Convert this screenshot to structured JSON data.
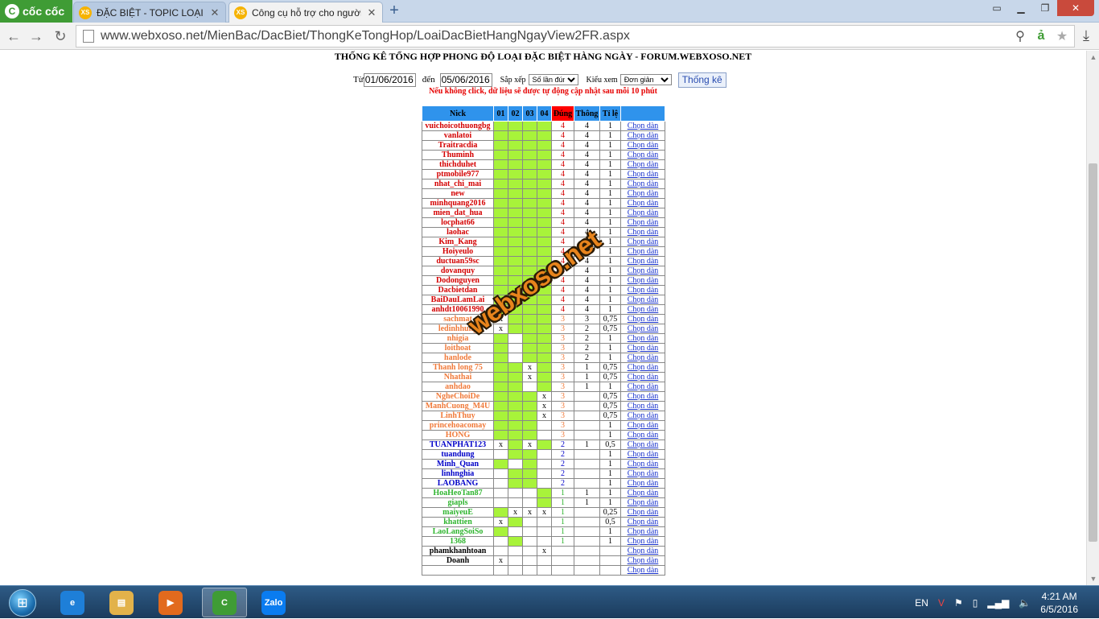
{
  "browser": {
    "logo": "cốc cốc",
    "tabs": [
      {
        "favicon": "XS",
        "title": "ĐẶC BIỆT - TOPIC LOẠI ĐẶ"
      },
      {
        "favicon": "XS",
        "title": "Công cụ hỗ trợ cho người"
      }
    ],
    "new_tab": "+",
    "url": "www.webxoso.net/MienBac/DacBiet/ThongKeTongHop/LoaiDacBietHangNgayView2FR.aspx"
  },
  "page": {
    "title": "THỐNG KÊ TỔNG HỢP PHONG ĐỘ LOẠI ĐẶC BIỆT HÀNG NGÀY - FORUM.WEBXOSO.NET",
    "from_label": "Từ",
    "from_value": "01/06/2016",
    "to_label": "đến",
    "to_value": "05/06/2016",
    "sort_label": "Sắp xếp",
    "sort_value": "Số lần đúng",
    "view_label": "Kiểu xem",
    "view_value": "Đơn giản",
    "submit_label": "Thống kê",
    "note": "Nếu không click, dữ liệu sẽ được tự động cập nhật sau mỗi 10 phút",
    "watermark": "webxoso.net"
  },
  "table": {
    "headers": [
      "Nick",
      "01",
      "02",
      "03",
      "04",
      "Đúng",
      "Thông",
      "Tỉ lệ",
      ""
    ],
    "link_label": "Chọn dàn",
    "colors": {
      "4": "#d40000",
      "3": "#f07a3a",
      "2": "#0000c8",
      "1": "#2fb52f",
      "0": "#000000"
    },
    "rows": [
      {
        "nick": "vuichoicothuongbg",
        "d": [
          "g",
          "g",
          "g",
          "g"
        ],
        "dung": "4",
        "thong": "4",
        "tile": "1"
      },
      {
        "nick": "vanlatoi",
        "d": [
          "g",
          "g",
          "g",
          "g"
        ],
        "dung": "4",
        "thong": "4",
        "tile": "1"
      },
      {
        "nick": "Traitracdia",
        "d": [
          "g",
          "g",
          "g",
          "g"
        ],
        "dung": "4",
        "thong": "4",
        "tile": "1"
      },
      {
        "nick": "Thuminh",
        "d": [
          "g",
          "g",
          "g",
          "g"
        ],
        "dung": "4",
        "thong": "4",
        "tile": "1"
      },
      {
        "nick": "thichduhet",
        "d": [
          "g",
          "g",
          "g",
          "g"
        ],
        "dung": "4",
        "thong": "4",
        "tile": "1"
      },
      {
        "nick": "ptmobile977",
        "d": [
          "g",
          "g",
          "g",
          "g"
        ],
        "dung": "4",
        "thong": "4",
        "tile": "1"
      },
      {
        "nick": "nhat_chi_mai",
        "d": [
          "g",
          "g",
          "g",
          "g"
        ],
        "dung": "4",
        "thong": "4",
        "tile": "1"
      },
      {
        "nick": "new",
        "d": [
          "g",
          "g",
          "g",
          "g"
        ],
        "dung": "4",
        "thong": "4",
        "tile": "1"
      },
      {
        "nick": "minhquang2016",
        "d": [
          "g",
          "g",
          "g",
          "g"
        ],
        "dung": "4",
        "thong": "4",
        "tile": "1"
      },
      {
        "nick": "mien_dat_hua",
        "d": [
          "g",
          "g",
          "g",
          "g"
        ],
        "dung": "4",
        "thong": "4",
        "tile": "1"
      },
      {
        "nick": "locphat66",
        "d": [
          "g",
          "g",
          "g",
          "g"
        ],
        "dung": "4",
        "thong": "4",
        "tile": "1"
      },
      {
        "nick": "laohac",
        "d": [
          "g",
          "g",
          "g",
          "g"
        ],
        "dung": "4",
        "thong": "4",
        "tile": "1"
      },
      {
        "nick": "Kim_Kang",
        "d": [
          "g",
          "g",
          "g",
          "g"
        ],
        "dung": "4",
        "thong": "4",
        "tile": "1"
      },
      {
        "nick": "Hoiyeulo",
        "d": [
          "g",
          "g",
          "g",
          "g"
        ],
        "dung": "4",
        "thong": "4",
        "tile": "1"
      },
      {
        "nick": "ductuan59sc",
        "d": [
          "g",
          "g",
          "g",
          "g"
        ],
        "dung": "4",
        "thong": "4",
        "tile": "1"
      },
      {
        "nick": "dovanquy",
        "d": [
          "g",
          "g",
          "g",
          "g"
        ],
        "dung": "4",
        "thong": "4",
        "tile": "1"
      },
      {
        "nick": "Dodonguyen",
        "d": [
          "g",
          "g",
          "g",
          "g"
        ],
        "dung": "4",
        "thong": "4",
        "tile": "1"
      },
      {
        "nick": "Dacbietdan",
        "d": [
          "g",
          "g",
          "g",
          "g"
        ],
        "dung": "4",
        "thong": "4",
        "tile": "1"
      },
      {
        "nick": "BaiDauLamLai",
        "d": [
          "g",
          "g",
          "g",
          "g"
        ],
        "dung": "4",
        "thong": "4",
        "tile": "1"
      },
      {
        "nick": "anhdt10061990",
        "d": [
          "g",
          "g",
          "g",
          "g"
        ],
        "dung": "4",
        "thong": "4",
        "tile": "1"
      },
      {
        "nick": "sachmat",
        "d": [
          "x",
          "g",
          "g",
          "g"
        ],
        "dung": "3",
        "thong": "3",
        "tile": "0,75"
      },
      {
        "nick": "ledinhhung",
        "d": [
          "x",
          "g",
          "g",
          "g"
        ],
        "dung": "3",
        "thong": "2",
        "tile": "0,75"
      },
      {
        "nick": "nhigia",
        "d": [
          "g",
          "",
          "g",
          "g"
        ],
        "dung": "3",
        "thong": "2",
        "tile": "1"
      },
      {
        "nick": "loithoat",
        "d": [
          "g",
          "",
          "g",
          "g"
        ],
        "dung": "3",
        "thong": "2",
        "tile": "1"
      },
      {
        "nick": "hanlode",
        "d": [
          "g",
          "",
          "g",
          "g"
        ],
        "dung": "3",
        "thong": "2",
        "tile": "1"
      },
      {
        "nick": "Thanh long 75",
        "d": [
          "g",
          "g",
          "x",
          "g"
        ],
        "dung": "3",
        "thong": "1",
        "tile": "0,75"
      },
      {
        "nick": "Nhathai",
        "d": [
          "g",
          "g",
          "x",
          "g"
        ],
        "dung": "3",
        "thong": "1",
        "tile": "0,75"
      },
      {
        "nick": "anhdao",
        "d": [
          "g",
          "g",
          "",
          "g"
        ],
        "dung": "3",
        "thong": "1",
        "tile": "1"
      },
      {
        "nick": "NgheChoiDe",
        "d": [
          "g",
          "g",
          "g",
          "x"
        ],
        "dung": "3",
        "thong": "",
        "tile": "0,75"
      },
      {
        "nick": "ManhCuong_M4U",
        "d": [
          "g",
          "g",
          "g",
          "x"
        ],
        "dung": "3",
        "thong": "",
        "tile": "0,75"
      },
      {
        "nick": "LinhThuy",
        "d": [
          "g",
          "g",
          "g",
          "x"
        ],
        "dung": "3",
        "thong": "",
        "tile": "0,75"
      },
      {
        "nick": "princehoacomay",
        "d": [
          "g",
          "g",
          "g",
          ""
        ],
        "dung": "3",
        "thong": "",
        "tile": "1"
      },
      {
        "nick": "HONG",
        "d": [
          "g",
          "g",
          "g",
          ""
        ],
        "dung": "3",
        "thong": "",
        "tile": "1"
      },
      {
        "nick": "TUANPHAT123",
        "d": [
          "x",
          "g",
          "x",
          "g"
        ],
        "dung": "2",
        "thong": "1",
        "tile": "0,5"
      },
      {
        "nick": "tuandung",
        "d": [
          "",
          "g",
          "g",
          ""
        ],
        "dung": "2",
        "thong": "",
        "tile": "1"
      },
      {
        "nick": "Minh_Quan",
        "d": [
          "g",
          "",
          "g",
          ""
        ],
        "dung": "2",
        "thong": "",
        "tile": "1"
      },
      {
        "nick": "linhnghia",
        "d": [
          "",
          "g",
          "g",
          ""
        ],
        "dung": "2",
        "thong": "",
        "tile": "1"
      },
      {
        "nick": "LAOBANG",
        "d": [
          "",
          "g",
          "g",
          ""
        ],
        "dung": "2",
        "thong": "",
        "tile": "1"
      },
      {
        "nick": "HoaHeoTan87",
        "d": [
          "",
          "",
          "",
          "g"
        ],
        "dung": "1",
        "thong": "1",
        "tile": "1"
      },
      {
        "nick": "giapls",
        "d": [
          "",
          "",
          "",
          "g"
        ],
        "dung": "1",
        "thong": "1",
        "tile": "1"
      },
      {
        "nick": "maiyeuE",
        "d": [
          "g",
          "x",
          "x",
          "x"
        ],
        "dung": "1",
        "thong": "",
        "tile": "0,25"
      },
      {
        "nick": "khattien",
        "d": [
          "x",
          "g",
          "",
          ""
        ],
        "dung": "1",
        "thong": "",
        "tile": "0,5"
      },
      {
        "nick": "LaoLangSoiSo",
        "d": [
          "g",
          "",
          "",
          ""
        ],
        "dung": "1",
        "thong": "",
        "tile": "1"
      },
      {
        "nick": "1368",
        "d": [
          "",
          "g",
          "",
          ""
        ],
        "dung": "1",
        "thong": "",
        "tile": "1"
      },
      {
        "nick": "phamkhanhtoan",
        "d": [
          "",
          "",
          "",
          "x"
        ],
        "dung": "",
        "thong": "",
        "tile": ""
      },
      {
        "nick": "Doanh",
        "d": [
          "x",
          "",
          "",
          ""
        ],
        "dung": "",
        "thong": "",
        "tile": ""
      },
      {
        "nick": "",
        "d": [
          "",
          "",
          "",
          ""
        ],
        "dung": "",
        "thong": "",
        "tile": ""
      }
    ]
  },
  "taskbar": {
    "apps": [
      {
        "name": "internet-explorer",
        "label": "e",
        "color": "#1e7fd8"
      },
      {
        "name": "file-explorer",
        "label": "▤",
        "color": "#e2b24a"
      },
      {
        "name": "media-player",
        "label": "▶",
        "color": "#e26a1d"
      },
      {
        "name": "coccoc-browser",
        "label": "C",
        "color": "#3f9c35"
      },
      {
        "name": "zalo",
        "label": "Zalo",
        "color": "#0a7cf0"
      }
    ],
    "lang": "EN",
    "time": "4:21 AM",
    "date": "6/5/2016"
  }
}
